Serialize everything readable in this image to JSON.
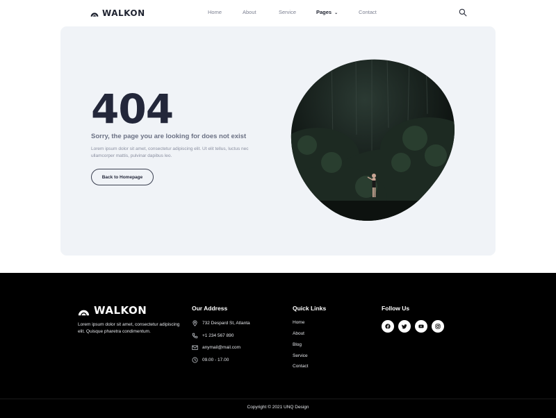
{
  "header": {
    "brand": "WALKON",
    "nav": [
      {
        "label": "Home"
      },
      {
        "label": "About"
      },
      {
        "label": "Service"
      },
      {
        "label": "Pages"
      },
      {
        "label": "Contact"
      }
    ],
    "search_icon": "search-icon"
  },
  "hero": {
    "code": "404",
    "title": "Sorry, the page you are looking for does not exist",
    "description": "Lorem ipsum dolor sit amet, consectetur adipiscing elit. Ut elit tellus, luctus nec ullamcorper mattis, pulvinar dapibus leo.",
    "button": "Back to Homepage"
  },
  "footer": {
    "brand": "WALKON",
    "about": "Lorem ipsum dolor sit amet, consectetur adipiscing elit. Quisque pharetra condimentum.",
    "address_heading": "Our Address",
    "address_items": [
      {
        "icon": "location-icon",
        "text": "732 Despard St, Atlanta"
      },
      {
        "icon": "phone-icon",
        "text": "+1 234 567 890"
      },
      {
        "icon": "mail-icon",
        "text": "anymail@mail.com"
      },
      {
        "icon": "clock-icon",
        "text": "09.00 - 17.00"
      }
    ],
    "links_heading": "Quick Links",
    "links": [
      "Home",
      "About",
      "Blog",
      "Service",
      "Contact"
    ],
    "follow_heading": "Follow Us",
    "socials": [
      "facebook-icon",
      "twitter-icon",
      "youtube-icon",
      "instagram-icon"
    ],
    "copyright": "Copyright © 2021 UNQ Design"
  },
  "colors": {
    "dark": "#23273a",
    "muted": "#6b7184",
    "card_bg": "#f0f3f7",
    "footer_bg": "#000000"
  }
}
